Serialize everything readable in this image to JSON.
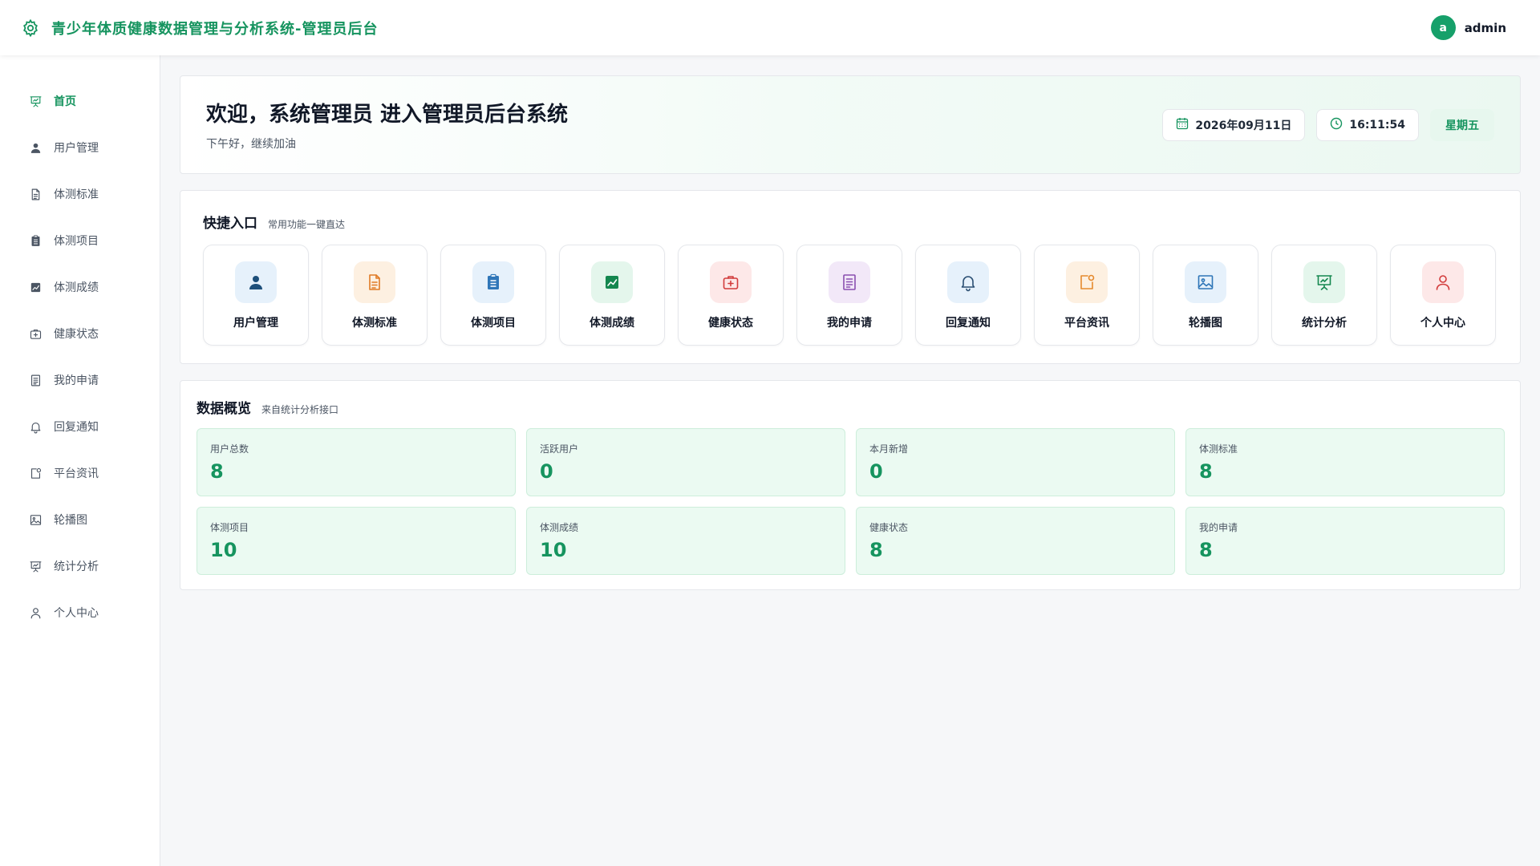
{
  "header": {
    "icon": "settings-gear-icon",
    "title": "青少年体质健康数据管理与分析系统-管理员后台",
    "avatar_letter": "a",
    "username": "admin",
    "accent_color": "#16945f"
  },
  "sidebar": {
    "items": [
      {
        "label": "首页",
        "icon": "presentation-board-icon",
        "active": true
      },
      {
        "label": "用户管理",
        "icon": "user-icon"
      },
      {
        "label": "体测标准",
        "icon": "document-icon"
      },
      {
        "label": "体测项目",
        "icon": "clipboard-icon"
      },
      {
        "label": "体测成绩",
        "icon": "chart-icon"
      },
      {
        "label": "健康状态",
        "icon": "medical-kit-icon"
      },
      {
        "label": "我的申请",
        "icon": "form-icon"
      },
      {
        "label": "回复通知",
        "icon": "bell-icon"
      },
      {
        "label": "平台资讯",
        "icon": "news-icon"
      },
      {
        "label": "轮播图",
        "icon": "image-icon"
      },
      {
        "label": "统计分析",
        "icon": "statistics-board-icon"
      },
      {
        "label": "个人中心",
        "icon": "user-outline-icon"
      }
    ]
  },
  "welcome": {
    "title": "欢迎，系统管理员 进入管理员后台系统",
    "subtitle": "下午好，继续加油",
    "date": "2026年09月11日",
    "time": "16:11:54",
    "weekday": "星期五"
  },
  "quick": {
    "title": "快捷入口",
    "subtitle": "常用功能一键直达",
    "items": [
      {
        "label": "用户管理",
        "icon": "user-icon",
        "bg": "#e6f1fb",
        "color": "#1d4f7a"
      },
      {
        "label": "体测标准",
        "icon": "document-icon",
        "bg": "#fdf0e1",
        "color": "#e07b26"
      },
      {
        "label": "体测项目",
        "icon": "clipboard-icon",
        "bg": "#e6f1fb",
        "color": "#2f76b8"
      },
      {
        "label": "体测成绩",
        "icon": "chart-icon",
        "bg": "#e4f6ec",
        "color": "#14874f"
      },
      {
        "label": "健康状态",
        "icon": "medical-kit-icon",
        "bg": "#fde8e8",
        "color": "#d23b3b"
      },
      {
        "label": "我的申请",
        "icon": "form-icon",
        "bg": "#f2e8f8",
        "color": "#8a4fb0"
      },
      {
        "label": "回复通知",
        "icon": "bell-icon",
        "bg": "#e6f1fb",
        "color": "#2b4f73"
      },
      {
        "label": "平台资讯",
        "icon": "news-icon",
        "bg": "#fdf0e1",
        "color": "#e58a2e"
      },
      {
        "label": "轮播图",
        "icon": "image-icon",
        "bg": "#e6f1fb",
        "color": "#2f76b8"
      },
      {
        "label": "统计分析",
        "icon": "statistics-board-icon",
        "bg": "#e4f6ec",
        "color": "#14874f"
      },
      {
        "label": "个人中心",
        "icon": "user-outline-icon",
        "bg": "#fde8e8",
        "color": "#d23b3b"
      }
    ]
  },
  "overview": {
    "title": "数据概览",
    "subtitle": "来自统计分析接口",
    "stats": [
      {
        "label": "用户总数",
        "value": "8"
      },
      {
        "label": "活跃用户",
        "value": "0"
      },
      {
        "label": "本月新增",
        "value": "0"
      },
      {
        "label": "体测标准",
        "value": "8"
      },
      {
        "label": "体测项目",
        "value": "10"
      },
      {
        "label": "体测成绩",
        "value": "10"
      },
      {
        "label": "健康状态",
        "value": "8"
      },
      {
        "label": "我的申请",
        "value": "8"
      }
    ]
  }
}
